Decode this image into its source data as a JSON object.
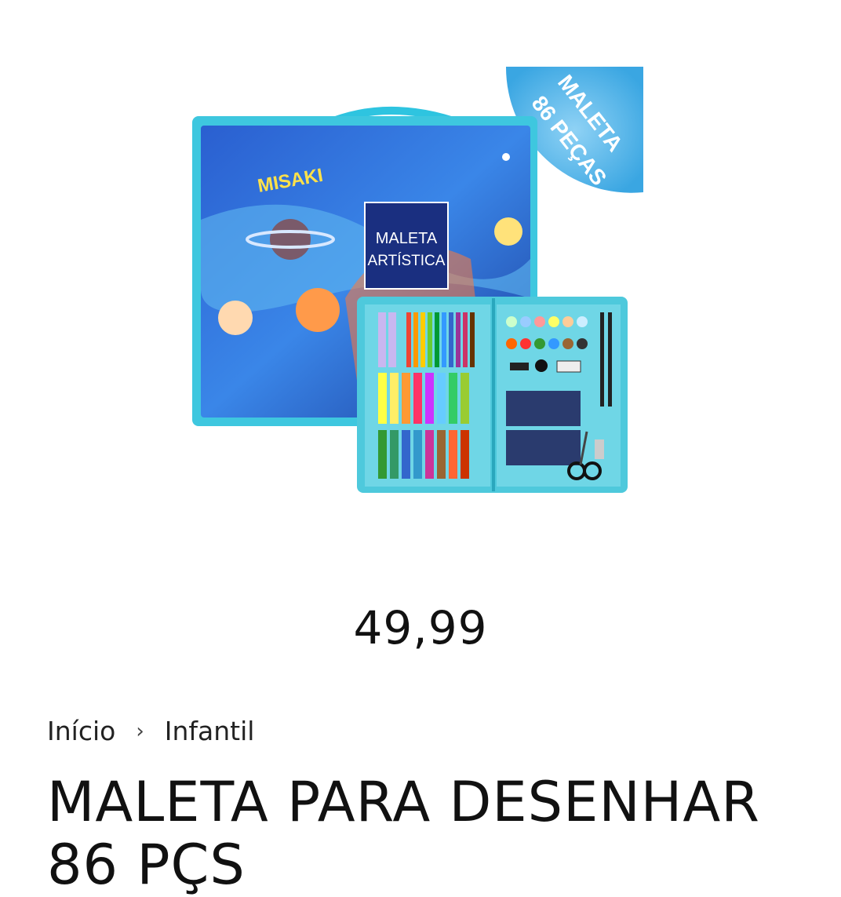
{
  "product": {
    "image": {
      "brand_text": "MISAKI",
      "box_label_line1": "MALETA",
      "box_label_line2": "ARTÍSTICA",
      "badge_line1": "MALETA",
      "badge_line2": "86 PEÇAS",
      "accent_color": "#4fb7e8",
      "case_color": "#4ec9dc"
    },
    "price": "49,99",
    "title": "MALETA PARA DESENHAR 86 PÇS"
  },
  "breadcrumb": {
    "home": "Início",
    "separator": "›",
    "category": "Infantil"
  }
}
